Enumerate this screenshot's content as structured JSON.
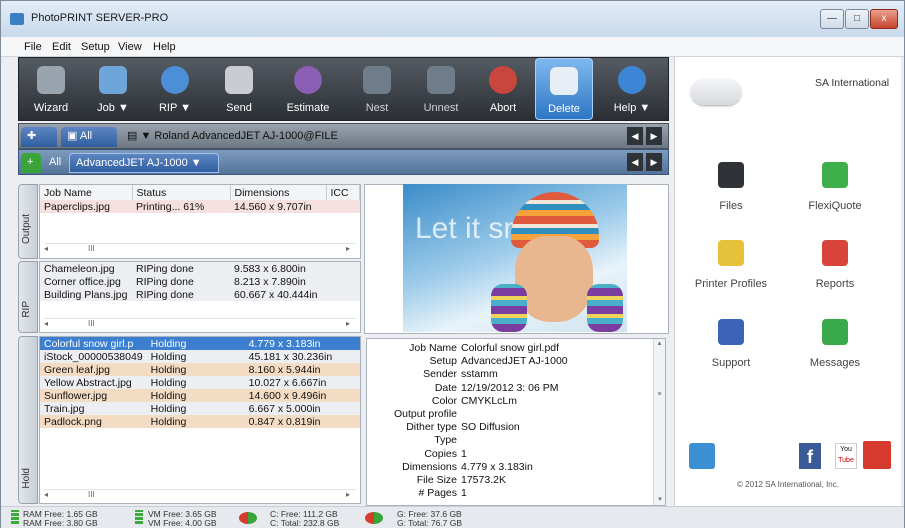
{
  "app": {
    "title": "PhotoPRINT SERVER-PRO"
  },
  "window_buttons": {
    "minimize": "—",
    "maximize": "□",
    "close": "x"
  },
  "menu": [
    "File",
    "Edit",
    "Setup",
    "View",
    "Help"
  ],
  "toolbar": [
    {
      "label": "Wizard",
      "icon": "wizard-icon",
      "color": "#9aa4ae"
    },
    {
      "label": "Job ▼",
      "icon": "job-folder-icon",
      "color": "#6fa6d9"
    },
    {
      "label": "RIP ▼",
      "icon": "globe-icon",
      "color": "#4b8fd6"
    },
    {
      "label": "Send",
      "icon": "printer-icon",
      "color": "#c9cdd2"
    },
    {
      "label": "Estimate",
      "icon": "estimate-gauge-icon",
      "color": "#8a5fb3"
    },
    {
      "label": "Nest",
      "icon": "nest-icon",
      "color": "#6f7c89"
    },
    {
      "label": "Unnest",
      "icon": "unnest-icon",
      "color": "#6f7c89"
    },
    {
      "label": "Abort",
      "icon": "abort-icon",
      "color": "#c9463c"
    },
    {
      "label": "Delete",
      "icon": "trash-icon",
      "color": "#e8eef5"
    },
    {
      "label": "Help ▼",
      "icon": "help-icon",
      "color": "#3d86d6"
    }
  ],
  "printer_tab": {
    "all_label": "All",
    "printer_name": "Roland AdvancedJET AJ-1000@FILE"
  },
  "queue_tab": {
    "all_label": "All",
    "queue_name": "AdvancedJET AJ-1000",
    "dropdown": "▼"
  },
  "nav": {
    "left": "◀",
    "right": "▶"
  },
  "side_tabs": {
    "output": "Output",
    "rip": "RIP",
    "hold": "Hold"
  },
  "columns": [
    "Job Name",
    "Status",
    "Dimensions",
    "ICC"
  ],
  "output_rows": [
    {
      "name": "Paperclips.jpg",
      "status": "Printing... 61%",
      "dims": "14.560 x 9.707in"
    }
  ],
  "rip_rows": [
    {
      "name": "Chameleon.jpg",
      "status": "RIPing done",
      "dims": "9.583 x 6.800in"
    },
    {
      "name": "Corner office.jpg",
      "status": "RIPing done",
      "dims": "8.213 x 7.890in"
    },
    {
      "name": "Building Plans.jpg",
      "status": "RIPing done",
      "dims": "60.667 x 40.444in"
    }
  ],
  "hold_rows": [
    {
      "name": "Colorful snow girl.p",
      "status": "Holding",
      "dims": "4.779 x 3.183in",
      "style": "sel"
    },
    {
      "name": "iStock_00000538049",
      "status": "Holding",
      "dims": "45.181 x 30.236in",
      "style": "gray"
    },
    {
      "name": "Green leaf.jpg",
      "status": "Holding",
      "dims": "8.160 x 5.944in",
      "style": "peach"
    },
    {
      "name": "Yellow Abstract.jpg",
      "status": "Holding",
      "dims": "10.027 x 6.667in",
      "style": "gray"
    },
    {
      "name": "Sunflower.jpg",
      "status": "Holding",
      "dims": "14.600 x 9.496in",
      "style": "peach"
    },
    {
      "name": "Train.jpg",
      "status": "Holding",
      "dims": "6.667 x 5.000in",
      "style": "gray"
    },
    {
      "name": "Padlock.png",
      "status": "Holding",
      "dims": "0.847 x 0.819in",
      "style": "peach"
    }
  ],
  "scroll": {
    "left": "◂",
    "right": "▸",
    "thumb": "III",
    "up": "▴",
    "down": "▾",
    "grip": "≡"
  },
  "preview": {
    "text": "Let it snow!"
  },
  "details": [
    {
      "k": "Job Name",
      "v": "Colorful snow girl.pdf"
    },
    {
      "k": "Setup",
      "v": "AdvancedJET AJ-1000"
    },
    {
      "k": "Sender",
      "v": "sstamm"
    },
    {
      "k": "Date",
      "v": "12/19/2012 3: 06 PM"
    },
    {
      "k": "Color",
      "v": "CMYKLcLm"
    },
    {
      "k": "Output profile",
      "v": ""
    },
    {
      "k": "Dither type",
      "v": "SO Diffusion"
    },
    {
      "k": "Type",
      "v": ""
    },
    {
      "k": "Copies",
      "v": "1"
    },
    {
      "k": "Dimensions",
      "v": "4.779 x 3.183in"
    },
    {
      "k": "File Size",
      "v": "17573.2K"
    },
    {
      "k": "# Pages",
      "v": "1"
    }
  ],
  "right_panel": {
    "brand": "SA International",
    "items": [
      {
        "label": "Files",
        "icon": "files-icon",
        "color": "#2f3338"
      },
      {
        "label": "FlexiQuote",
        "icon": "flexiquote-icon",
        "color": "#3cae4a"
      },
      {
        "label": "Printer Profiles",
        "icon": "printer-profiles-icon",
        "color": "#e6c23a"
      },
      {
        "label": "Reports",
        "icon": "reports-icon",
        "color": "#d8433a"
      },
      {
        "label": "Support",
        "icon": "support-icon",
        "color": "#3b63b8"
      },
      {
        "label": "Messages",
        "icon": "messages-icon",
        "color": "#3aa94a"
      }
    ],
    "copyright": "© 2012 SA International, Inc.",
    "social": {
      "f": "f",
      "yt_top": "You",
      "yt_bottom": "Tube"
    }
  },
  "status": {
    "ram_free": "RAM Free: 1.65 GB",
    "ram_free2": "RAM Free: 3.80 GB",
    "vm_free": "VM Free: 3.65 GB",
    "vm_free2": "VM Free: 4.00 GB",
    "c_free": "C: Free: 111.2 GB",
    "c_total": "C: Total: 232.8 GB",
    "g_free": "G: Free: 37.6 GB",
    "g_total": "G: Total: 76.7 GB"
  }
}
